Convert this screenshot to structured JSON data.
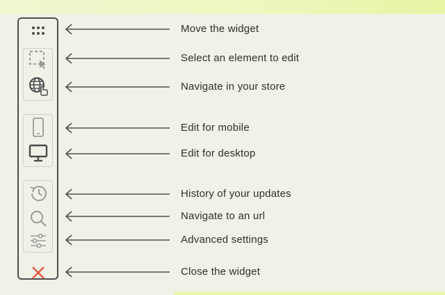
{
  "colors": {
    "background": "#f1f1e8",
    "toolbar_border": "#4d4d4d",
    "icon_muted": "#9a9a9a",
    "icon_dark": "#4a4a4a",
    "close_red": "#e35a3d",
    "accent_stripe": "#e6f6a4"
  },
  "toolbar": {
    "tools": [
      {
        "icon": "drag-handle-icon",
        "label": "Move the widget"
      },
      {
        "icon": "select-element-icon",
        "label": "Select an element to edit"
      },
      {
        "icon": "globe-navigate-icon",
        "label": "Navigate in your store"
      },
      {
        "icon": "mobile-icon",
        "label": "Edit for mobile"
      },
      {
        "icon": "desktop-icon",
        "label": "Edit for desktop"
      },
      {
        "icon": "history-icon",
        "label": "History of your updates"
      },
      {
        "icon": "search-icon",
        "label": "Navigate to an url"
      },
      {
        "icon": "sliders-icon",
        "label": "Advanced settings"
      },
      {
        "icon": "close-icon",
        "label": "Close the widget"
      }
    ]
  }
}
